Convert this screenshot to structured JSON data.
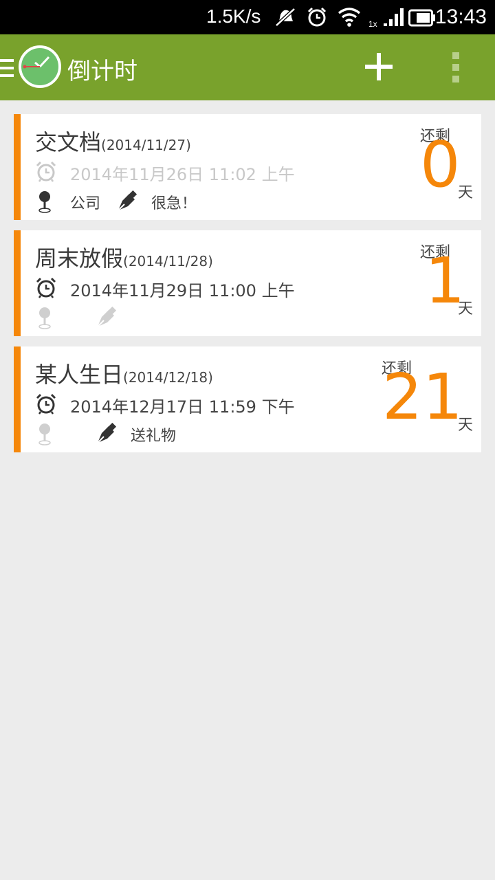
{
  "status_bar": {
    "net_speed": "1.5K/s",
    "time": "13:43",
    "signal_label": "1x",
    "icons": [
      "mute-icon",
      "alarm-icon",
      "wifi-icon",
      "signal-icon",
      "battery-icon"
    ]
  },
  "app_bar": {
    "title": "倒计时",
    "actions": [
      "add-icon",
      "overflow-menu-icon"
    ]
  },
  "colors": {
    "app_bar": "#79a22c",
    "accent": "#f5870a",
    "background": "#ececec"
  },
  "events": [
    {
      "title": "交文档",
      "date": "(2014/11/27)",
      "alarm": "2014年11月26日 11:02 上午",
      "alarm_active": false,
      "location": "公司",
      "note": "很急！",
      "remain_label": "还剩",
      "days": "0",
      "day_unit": "天"
    },
    {
      "title": "周末放假",
      "date": "(2014/11/28)",
      "alarm": "2014年11月29日 11:00 上午",
      "alarm_active": true,
      "location": "",
      "note": "",
      "remain_label": "还剩",
      "days": "1",
      "day_unit": "天"
    },
    {
      "title": "某人生日",
      "date": "(2014/12/18)",
      "alarm": "2014年12月17日 11:59 下午",
      "alarm_active": true,
      "location": "",
      "note": "送礼物",
      "remain_label": "还剩",
      "days": "21",
      "day_unit": "天"
    }
  ]
}
